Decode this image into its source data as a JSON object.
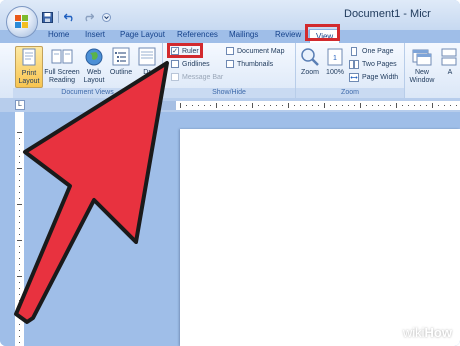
{
  "window": {
    "title": "Document1 - Micr"
  },
  "quick_access": {
    "icons": [
      "save-icon",
      "undo-icon",
      "redo-icon",
      "customize-icon"
    ]
  },
  "tabs": [
    {
      "label": "Home"
    },
    {
      "label": "Insert"
    },
    {
      "label": "Page Layout"
    },
    {
      "label": "References"
    },
    {
      "label": "Mailings"
    },
    {
      "label": "Review"
    },
    {
      "label": "View",
      "active": true
    }
  ],
  "ribbon": {
    "document_views": {
      "label": "Document Views",
      "buttons": [
        {
          "label_line1": "Print",
          "label_line2": "Layout",
          "selected": true
        },
        {
          "label_line1": "Full Screen",
          "label_line2": "Reading"
        },
        {
          "label_line1": "Web",
          "label_line2": "Layout"
        },
        {
          "label_line1": "Outline",
          "label_line2": ""
        },
        {
          "label_line1": "Dr",
          "label_line2": ""
        }
      ]
    },
    "show_hide": {
      "label": "Show/Hide",
      "ruler": {
        "label": "Ruler",
        "checked": true
      },
      "gridlines": {
        "label": "Gridlines",
        "checked": false
      },
      "message_bar": {
        "label": "Message Bar",
        "checked": false,
        "disabled": true
      },
      "document_map": {
        "label": "Document Map",
        "checked": false
      },
      "thumbnails": {
        "label": "Thumbnails",
        "checked": false
      }
    },
    "zoom": {
      "label": "Zoom",
      "zoom_button": "Zoom",
      "percent_button": "100%",
      "one_page": "One Page",
      "two_pages": "Two Pages",
      "page_width": "Page Width"
    },
    "window": {
      "new_window_line1": "New",
      "new_window_line2": "Window",
      "next_partial": "A"
    }
  },
  "ruler_corner": {
    "symbol": "L"
  },
  "colors": {
    "highlight": "#d22a2e",
    "arrow": "#e8323f",
    "ribbon": "#dbe7f7",
    "background": "#9fbee8"
  },
  "watermark": {
    "wiki": "wiki",
    "how": "How"
  }
}
